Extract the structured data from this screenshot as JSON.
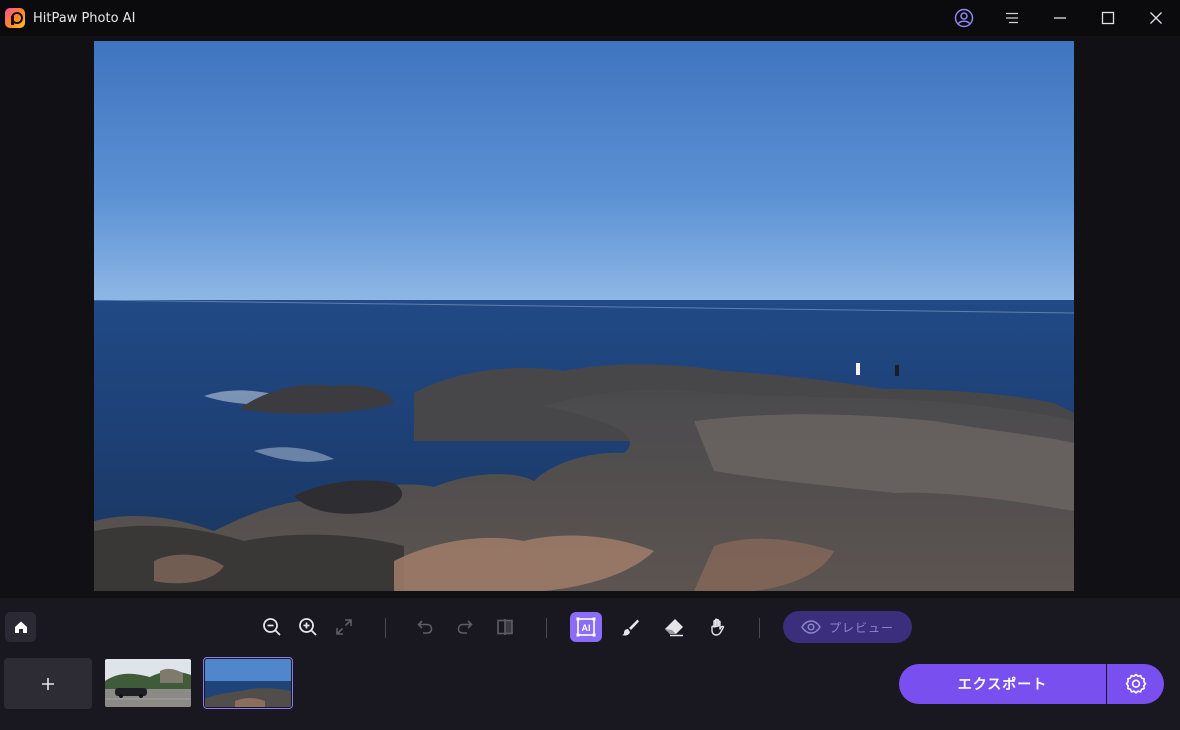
{
  "app": {
    "title": "HitPaw Photo AI"
  },
  "window_controls": {
    "icons": [
      "account-icon",
      "menu-icon",
      "minimize-icon",
      "maximize-icon",
      "close-icon"
    ]
  },
  "toolbar": {
    "tools": [
      "zoom-out-icon",
      "zoom-in-icon",
      "fit-screen-icon",
      "undo-icon",
      "redo-icon",
      "compare-icon",
      "ai-select-icon",
      "brush-icon",
      "eraser-icon",
      "hand-icon"
    ],
    "active_tool": "ai-select-icon",
    "preview_label": "プレビュー"
  },
  "bottom": {
    "export_label": "エクスポート",
    "add_label": "+",
    "thumbnails": [
      {
        "name": "thumbnail-car-parking",
        "selected": false
      },
      {
        "name": "thumbnail-rocky-coast",
        "selected": true
      }
    ]
  },
  "colors": {
    "accent": "#7a4ff0",
    "active_tool": "#8a6cf6",
    "preview_bg": "#3a2e7d",
    "background": "#0f0e13",
    "panel": "#19171f"
  }
}
